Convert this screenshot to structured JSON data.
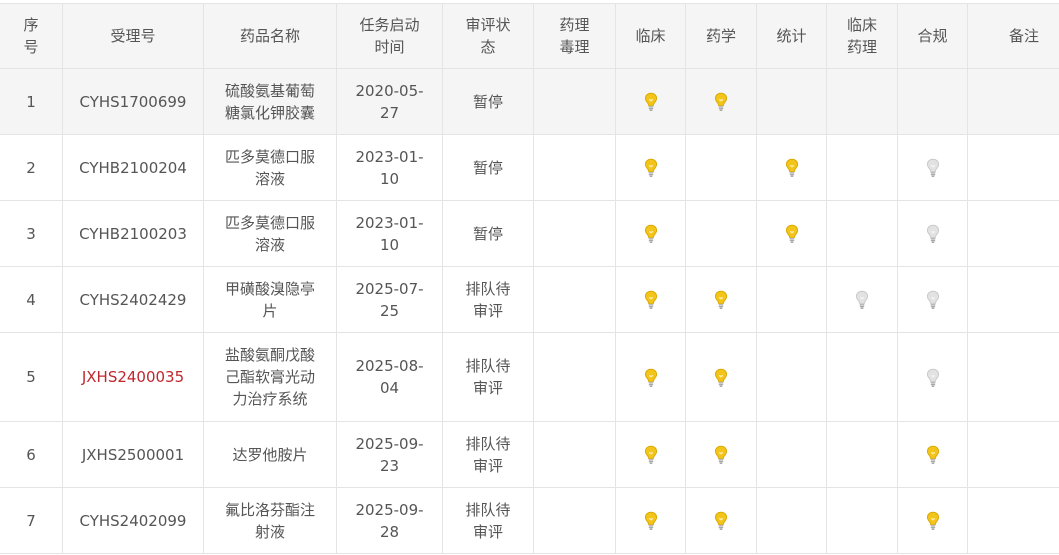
{
  "headers": [
    "序号",
    "受理号",
    "药品名称",
    "任务启动时间",
    "审评状态",
    "药理毒理",
    "临床",
    "药学",
    "统计",
    "临床药理",
    "合规",
    "备注"
  ],
  "header_lines": {
    "seq": [
      "序",
      "号"
    ],
    "accept_no": [
      "受理号"
    ],
    "drug_name": [
      "药品名称"
    ],
    "start_time": [
      "任务启动",
      "时间"
    ],
    "status": [
      "审评状",
      "态"
    ],
    "pharm_tox": [
      "药理",
      "毒理"
    ],
    "clinical": [
      "临床"
    ],
    "pharmacy": [
      "药学"
    ],
    "stats": [
      "统计"
    ],
    "clin_pharm": [
      "临床",
      "药理"
    ],
    "compliance": [
      "合规"
    ],
    "note": [
      "备注"
    ]
  },
  "colors": {
    "bulb_on": "#f3c51a",
    "bulb_off": "#e2e2e2",
    "accent_red": "#c0272d",
    "header_bg": "#f5f5f5"
  },
  "rows": [
    {
      "seq": "1",
      "accept_no": "CYHS1700699",
      "accept_no_red": false,
      "name_lines": [
        "硫酸氨基葡萄",
        "糖氯化钾胶囊"
      ],
      "date_lines": [
        "2020-05-",
        "27"
      ],
      "status_lines": [
        "暂停"
      ],
      "bulbs": {
        "pharm_tox": "none",
        "clinical": "on",
        "pharmacy": "on",
        "stats": "none",
        "clin_pharm": "none",
        "compliance": "none"
      },
      "highlight": true
    },
    {
      "seq": "2",
      "accept_no": "CYHB2100204",
      "accept_no_red": false,
      "name_lines": [
        "匹多莫德口服",
        "溶液"
      ],
      "date_lines": [
        "2023-01-",
        "10"
      ],
      "status_lines": [
        "暂停"
      ],
      "bulbs": {
        "pharm_tox": "none",
        "clinical": "on",
        "pharmacy": "none",
        "stats": "on",
        "clin_pharm": "none",
        "compliance": "off"
      },
      "highlight": false
    },
    {
      "seq": "3",
      "accept_no": "CYHB2100203",
      "accept_no_red": false,
      "name_lines": [
        "匹多莫德口服",
        "溶液"
      ],
      "date_lines": [
        "2023-01-",
        "10"
      ],
      "status_lines": [
        "暂停"
      ],
      "bulbs": {
        "pharm_tox": "none",
        "clinical": "on",
        "pharmacy": "none",
        "stats": "on",
        "clin_pharm": "none",
        "compliance": "off"
      },
      "highlight": false
    },
    {
      "seq": "4",
      "accept_no": "CYHS2402429",
      "accept_no_red": false,
      "name_lines": [
        "甲磺酸溴隐亭",
        "片"
      ],
      "date_lines": [
        "2025-07-",
        "25"
      ],
      "status_lines": [
        "排队待",
        "审评"
      ],
      "bulbs": {
        "pharm_tox": "none",
        "clinical": "on",
        "pharmacy": "on",
        "stats": "none",
        "clin_pharm": "off",
        "compliance": "off"
      },
      "highlight": false
    },
    {
      "seq": "5",
      "accept_no": "JXHS2400035",
      "accept_no_red": true,
      "name_lines": [
        "盐酸氨酮戊酸",
        "己酯软膏光动",
        "力治疗系统"
      ],
      "date_lines": [
        "2025-08-",
        "04"
      ],
      "status_lines": [
        "排队待",
        "审评"
      ],
      "bulbs": {
        "pharm_tox": "none",
        "clinical": "on",
        "pharmacy": "on",
        "stats": "none",
        "clin_pharm": "none",
        "compliance": "off"
      },
      "highlight": false
    },
    {
      "seq": "6",
      "accept_no": "JXHS2500001",
      "accept_no_red": false,
      "name_lines": [
        "达罗他胺片"
      ],
      "date_lines": [
        "2025-09-",
        "23"
      ],
      "status_lines": [
        "排队待",
        "审评"
      ],
      "bulbs": {
        "pharm_tox": "none",
        "clinical": "on",
        "pharmacy": "on",
        "stats": "none",
        "clin_pharm": "none",
        "compliance": "on"
      },
      "highlight": false
    },
    {
      "seq": "7",
      "accept_no": "CYHS2402099",
      "accept_no_red": false,
      "name_lines": [
        "氟比洛芬酯注",
        "射液"
      ],
      "date_lines": [
        "2025-09-",
        "28"
      ],
      "status_lines": [
        "排队待",
        "审评"
      ],
      "bulbs": {
        "pharm_tox": "none",
        "clinical": "on",
        "pharmacy": "on",
        "stats": "none",
        "clin_pharm": "none",
        "compliance": "on"
      },
      "highlight": false
    }
  ]
}
